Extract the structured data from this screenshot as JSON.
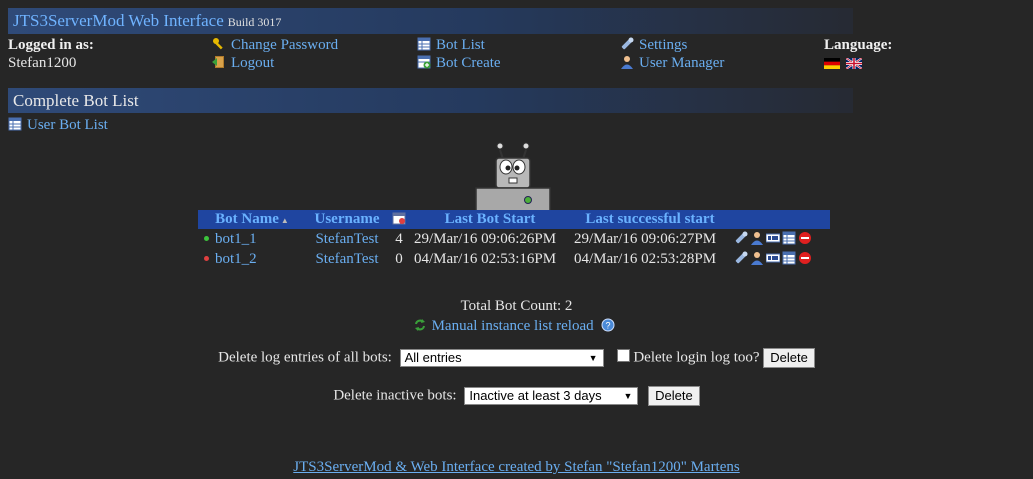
{
  "app": {
    "title": "JTS3ServerMod Web Interface",
    "build": "Build 3017"
  },
  "header": {
    "logged_in_label": "Logged in as:",
    "username": "Stefan1200",
    "change_password": "Change Password",
    "logout": "Logout",
    "bot_list": "Bot List",
    "bot_create": "Bot Create",
    "settings": "Settings",
    "user_manager": "User Manager",
    "language_label": "Language:",
    "languages": [
      "de-flag-icon",
      "uk-flag-icon"
    ]
  },
  "section": {
    "title": "Complete Bot List",
    "user_bot_list": "User Bot List"
  },
  "table": {
    "columns": [
      "Bot Name",
      "Username",
      "",
      "Last Bot Start",
      "Last successful start"
    ],
    "rows": [
      {
        "status": "running",
        "status_color": "#3cc43c",
        "name": "bot1_1",
        "user": "StefanTest",
        "count": "4",
        "last_start": "29/Mar/16 09:06:26PM",
        "last_success": "29/Mar/16 09:06:27PM"
      },
      {
        "status": "stopped",
        "status_color": "#e04040",
        "name": "bot1_2",
        "user": "StefanTest",
        "count": "0",
        "last_start": "04/Mar/16 02:53:16PM",
        "last_success": "04/Mar/16 02:53:28PM"
      }
    ]
  },
  "summary": {
    "total": "Total Bot Count: 2",
    "reload": "Manual instance list reload"
  },
  "delete_log": {
    "label": "Delete log entries of all bots:",
    "selected": "All entries",
    "checkbox_label": "Delete login log too?",
    "button": "Delete"
  },
  "delete_inactive": {
    "label": "Delete inactive bots:",
    "selected": "Inactive at least 3 days",
    "button": "Delete"
  },
  "footer": {
    "credit": "JTS3ServerMod & Web Interface created by Stefan \"Stefan1200\" Martens"
  }
}
